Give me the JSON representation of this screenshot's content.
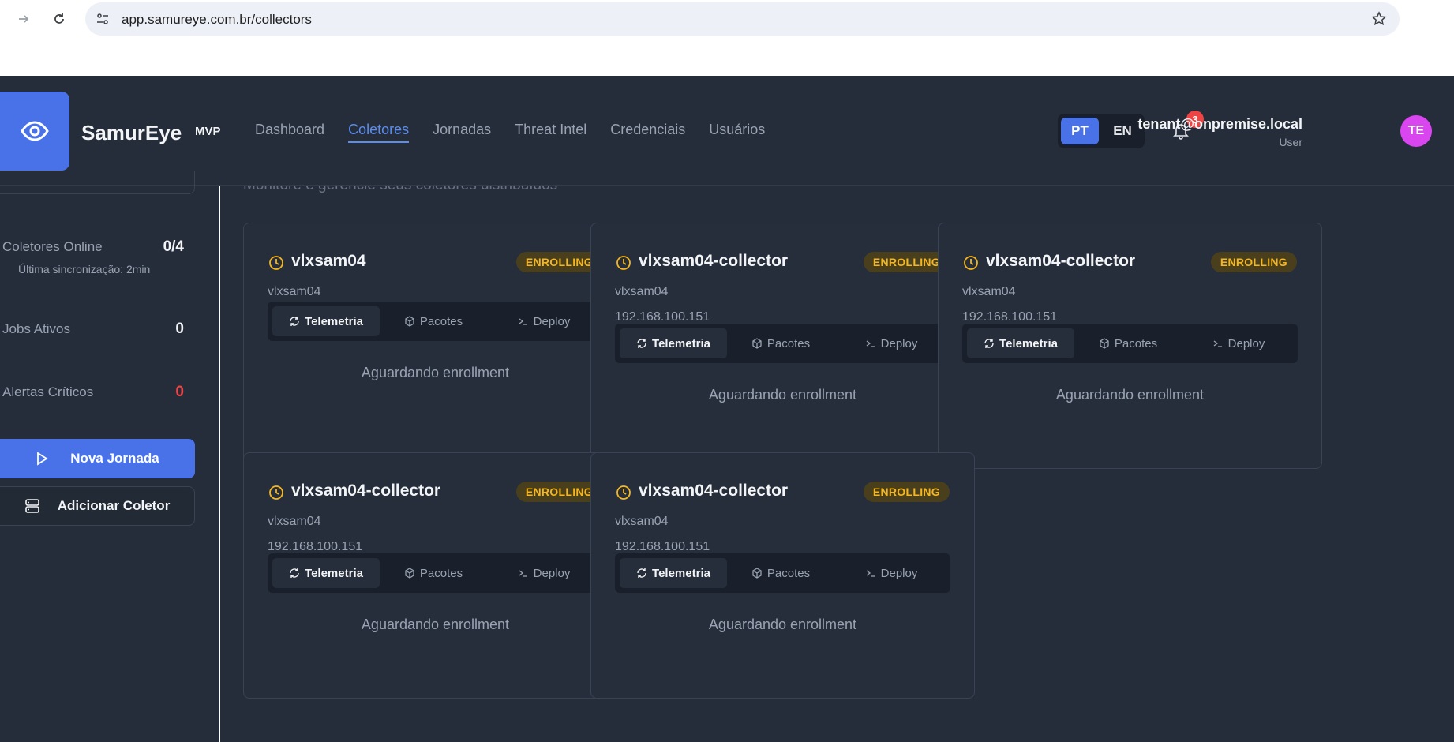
{
  "browser": {
    "url": "app.samureye.com.br/collectors"
  },
  "header": {
    "brand": "SamurEye",
    "tag": "MVP",
    "nav": [
      {
        "label": "Dashboard",
        "active": false
      },
      {
        "label": "Coletores",
        "active": true
      },
      {
        "label": "Jornadas",
        "active": false
      },
      {
        "label": "Threat Intel",
        "active": false
      },
      {
        "label": "Credenciais",
        "active": false
      },
      {
        "label": "Usuários",
        "active": false
      }
    ],
    "languages": [
      "PT",
      "EN"
    ],
    "active_language": "PT",
    "notification_count": "3",
    "user_email": "tenant@onpremise.local",
    "user_role": "User",
    "avatar_initials": "TE"
  },
  "sidebar": {
    "stats": {
      "online_label": "Coletores Online",
      "online_value": "0/4",
      "sync_text": "Última sincronização: 2min",
      "jobs_label": "Jobs Ativos",
      "jobs_value": "0",
      "alerts_label": "Alertas Críticos",
      "alerts_value": "0"
    },
    "new_journey_label": "Nova Jornada",
    "add_collector_label": "Adicionar Coletor"
  },
  "main": {
    "subtitle": "Monitore e gerencie seus coletores distribuídos",
    "cards": [
      {
        "name": "vlxsam04",
        "status": "ENROLLING",
        "host": "vlxsam04",
        "ip": "",
        "tabs": [
          "Telemetria",
          "Pacotes",
          "Deploy"
        ],
        "message": "Aguardando enrollment"
      },
      {
        "name": "vlxsam04-collector",
        "status": "ENROLLING",
        "host": "vlxsam04",
        "ip": "192.168.100.151",
        "tabs": [
          "Telemetria",
          "Pacotes",
          "Deploy"
        ],
        "message": "Aguardando enrollment"
      },
      {
        "name": "vlxsam04-collector",
        "status": "ENROLLING",
        "host": "vlxsam04",
        "ip": "192.168.100.151",
        "tabs": [
          "Telemetria",
          "Pacotes",
          "Deploy"
        ],
        "message": "Aguardando enrollment"
      },
      {
        "name": "vlxsam04-collector",
        "status": "ENROLLING",
        "host": "vlxsam04",
        "ip": "192.168.100.151",
        "tabs": [
          "Telemetria",
          "Pacotes",
          "Deploy"
        ],
        "message": "Aguardando enrollment"
      },
      {
        "name": "vlxsam04-collector",
        "status": "ENROLLING",
        "host": "vlxsam04",
        "ip": "192.168.100.151",
        "tabs": [
          "Telemetria",
          "Pacotes",
          "Deploy"
        ],
        "message": "Aguardando enrollment"
      }
    ]
  },
  "colors": {
    "accent": "#4a72e8",
    "background": "#252d3b",
    "enrolling": "#f5b61e",
    "danger": "#ef4444"
  }
}
